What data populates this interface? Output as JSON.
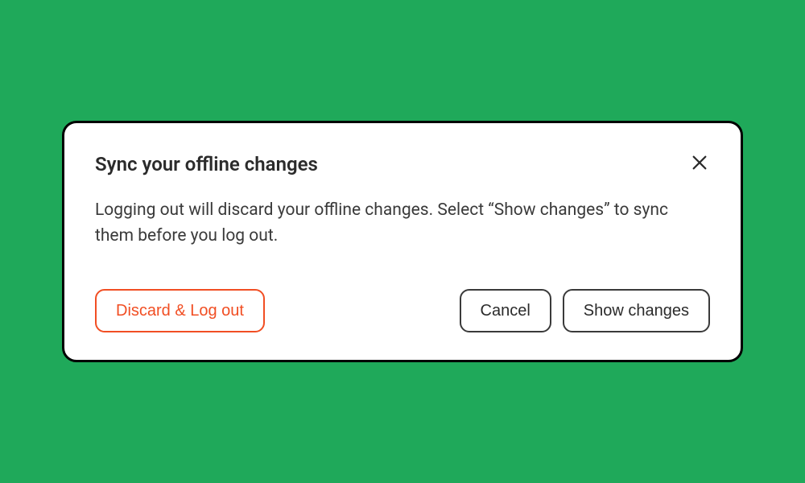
{
  "dialog": {
    "title": "Sync your offline changes",
    "body": "Logging out will discard your offline changes. Select “Show changes” to sync them before you log out.",
    "discard_label": "Discard & Log out",
    "cancel_label": "Cancel",
    "confirm_label": "Show changes"
  },
  "colors": {
    "background": "#1fa95a",
    "danger": "#f14e23",
    "text": "#2b2b2b"
  }
}
